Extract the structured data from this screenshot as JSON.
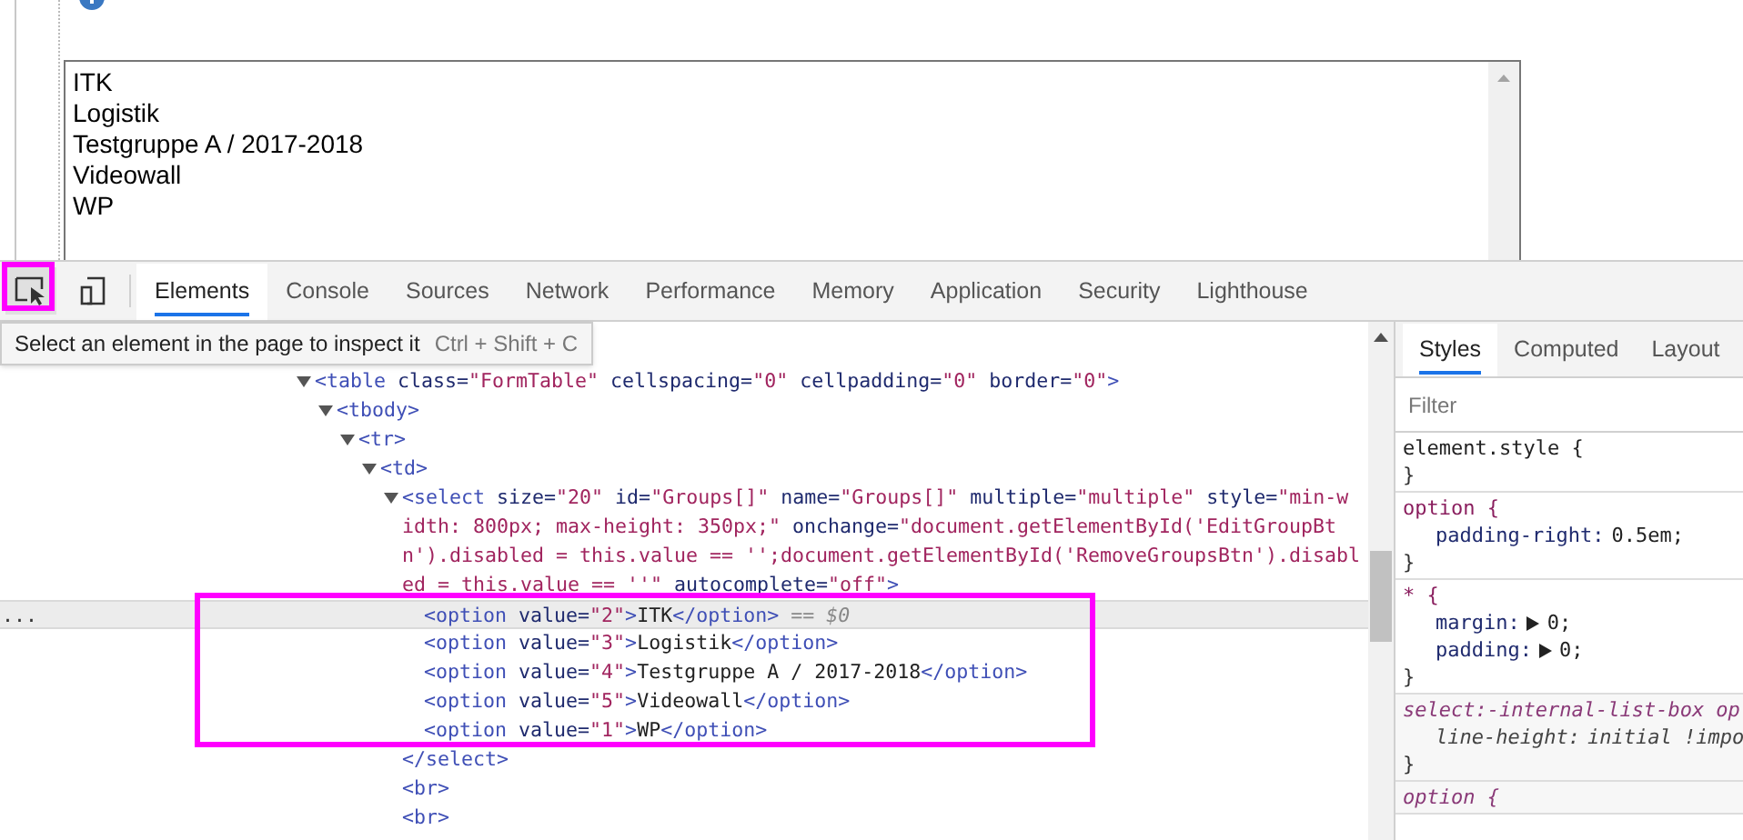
{
  "page": {
    "listbox": {
      "options": [
        {
          "label": "ITK"
        },
        {
          "label": "Logistik"
        },
        {
          "label": "Testgruppe A / 2017-2018"
        },
        {
          "label": "Videowall"
        },
        {
          "label": "WP"
        }
      ]
    }
  },
  "devtools": {
    "tools": [
      {
        "kind": "inspect"
      },
      {
        "kind": "device"
      }
    ],
    "tabs": [
      {
        "label": "Elements",
        "selected": true
      },
      {
        "label": "Console",
        "selected": false
      },
      {
        "label": "Sources",
        "selected": false
      },
      {
        "label": "Network",
        "selected": false
      },
      {
        "label": "Performance",
        "selected": false
      },
      {
        "label": "Memory",
        "selected": false
      },
      {
        "label": "Application",
        "selected": false
      },
      {
        "label": "Security",
        "selected": false
      },
      {
        "label": "Lighthouse",
        "selected": false
      }
    ],
    "tooltip": {
      "text": "Select an element in the page to inspect it",
      "shortcut": "Ctrl + Shift + C"
    },
    "dom": [
      {
        "expanded": true,
        "selected": false,
        "lines": [
          [
            {
              "kind": "tag",
              "text": "<table"
            },
            {
              "kind": "attr",
              "text": " class="
            },
            {
              "kind": "value",
              "text": "\"FormTable\""
            },
            {
              "kind": "attr",
              "text": " cellspacing="
            },
            {
              "kind": "value",
              "text": "\"0\""
            },
            {
              "kind": "attr",
              "text": " cellpadding="
            },
            {
              "kind": "value",
              "text": "\"0\""
            },
            {
              "kind": "attr",
              "text": " border="
            },
            {
              "kind": "value",
              "text": "\"0\""
            },
            {
              "kind": "tag",
              "text": ">"
            }
          ]
        ],
        "children": [
          {
            "expanded": true,
            "selected": false,
            "lines": [
              [
                {
                  "kind": "tag",
                  "text": "<tbody>"
                }
              ]
            ],
            "children": [
              {
                "expanded": true,
                "selected": false,
                "lines": [
                  [
                    {
                      "kind": "tag",
                      "text": "<tr>"
                    }
                  ]
                ],
                "children": [
                  {
                    "expanded": true,
                    "selected": false,
                    "lines": [
                      [
                        {
                          "kind": "tag",
                          "text": "<td>"
                        }
                      ]
                    ],
                    "children": [
                      {
                        "expanded": true,
                        "selected": false,
                        "lines": [
                          [
                            {
                              "kind": "tag",
                              "text": "<select"
                            },
                            {
                              "kind": "attr",
                              "text": " size="
                            },
                            {
                              "kind": "value",
                              "text": "\"20\""
                            },
                            {
                              "kind": "attr",
                              "text": " id="
                            },
                            {
                              "kind": "value",
                              "text": "\"Groups[]\""
                            },
                            {
                              "kind": "attr",
                              "text": " name="
                            },
                            {
                              "kind": "value",
                              "text": "\"Groups[]\""
                            },
                            {
                              "kind": "attr",
                              "text": " multiple="
                            },
                            {
                              "kind": "value",
                              "text": "\"multiple\""
                            },
                            {
                              "kind": "attr",
                              "text": " style="
                            },
                            {
                              "kind": "value",
                              "text": "\"min-w"
                            }
                          ],
                          [
                            {
                              "kind": "value",
                              "text": "idth: 800px; max-height: 350px;\""
                            },
                            {
                              "kind": "attr",
                              "text": " onchange="
                            },
                            {
                              "kind": "value",
                              "text": "\"document.getElementById('EditGroupBt"
                            }
                          ],
                          [
                            {
                              "kind": "value",
                              "text": "n').disabled = this.value == '';document.getElementById('RemoveGroupsBtn').disabl"
                            }
                          ],
                          [
                            {
                              "kind": "value",
                              "text": "ed = this.value == ''\""
                            },
                            {
                              "kind": "attr",
                              "text": " autocomplete="
                            },
                            {
                              "kind": "value",
                              "text": "\"off\""
                            },
                            {
                              "kind": "tag",
                              "text": ">"
                            }
                          ]
                        ],
                        "children": [
                          {
                            "selected": true,
                            "gutter": "...",
                            "lines": [
                              [
                                {
                                  "kind": "tag",
                                  "text": "<option"
                                },
                                {
                                  "kind": "attr",
                                  "text": " value="
                                },
                                {
                                  "kind": "value",
                                  "text": "\"2\""
                                },
                                {
                                  "kind": "tag",
                                  "text": ">"
                                },
                                {
                                  "kind": "text",
                                  "text": "ITK"
                                },
                                {
                                  "kind": "tag",
                                  "text": "</option>"
                                },
                                {
                                  "kind": "ref",
                                  "text": " == $0"
                                }
                              ]
                            ]
                          },
                          {
                            "selected": false,
                            "lines": [
                              [
                                {
                                  "kind": "tag",
                                  "text": "<option"
                                },
                                {
                                  "kind": "attr",
                                  "text": " value="
                                },
                                {
                                  "kind": "value",
                                  "text": "\"3\""
                                },
                                {
                                  "kind": "tag",
                                  "text": ">"
                                },
                                {
                                  "kind": "text",
                                  "text": "Logistik"
                                },
                                {
                                  "kind": "tag",
                                  "text": "</option>"
                                }
                              ]
                            ]
                          },
                          {
                            "selected": false,
                            "lines": [
                              [
                                {
                                  "kind": "tag",
                                  "text": "<option"
                                },
                                {
                                  "kind": "attr",
                                  "text": " value="
                                },
                                {
                                  "kind": "value",
                                  "text": "\"4\""
                                },
                                {
                                  "kind": "tag",
                                  "text": ">"
                                },
                                {
                                  "kind": "text",
                                  "text": "Testgruppe A / 2017-2018"
                                },
                                {
                                  "kind": "tag",
                                  "text": "</option>"
                                }
                              ]
                            ]
                          },
                          {
                            "selected": false,
                            "lines": [
                              [
                                {
                                  "kind": "tag",
                                  "text": "<option"
                                },
                                {
                                  "kind": "attr",
                                  "text": " value="
                                },
                                {
                                  "kind": "value",
                                  "text": "\"5\""
                                },
                                {
                                  "kind": "tag",
                                  "text": ">"
                                },
                                {
                                  "kind": "text",
                                  "text": "Videowall"
                                },
                                {
                                  "kind": "tag",
                                  "text": "</option>"
                                }
                              ]
                            ]
                          },
                          {
                            "selected": false,
                            "lines": [
                              [
                                {
                                  "kind": "tag",
                                  "text": "<option"
                                },
                                {
                                  "kind": "attr",
                                  "text": " value="
                                },
                                {
                                  "kind": "value",
                                  "text": "\"1\""
                                },
                                {
                                  "kind": "tag",
                                  "text": ">"
                                },
                                {
                                  "kind": "text",
                                  "text": "WP"
                                },
                                {
                                  "kind": "tag",
                                  "text": "</option>"
                                }
                              ]
                            ]
                          }
                        ],
                        "close": [
                          {
                            "kind": "tag",
                            "text": "</select>"
                          }
                        ]
                      },
                      {
                        "selected": false,
                        "lines": [
                          [
                            {
                              "kind": "tag",
                              "text": "<br>"
                            }
                          ]
                        ]
                      },
                      {
                        "selected": false,
                        "lines": [
                          [
                            {
                              "kind": "tag",
                              "text": "<br>"
                            }
                          ]
                        ]
                      }
                    ]
                  }
                ]
              }
            ]
          }
        ]
      }
    ],
    "styles": {
      "tabs": [
        {
          "label": "Styles",
          "selected": true
        },
        {
          "label": "Computed",
          "selected": false
        },
        {
          "label": "Layout",
          "selected": false
        }
      ],
      "filter_placeholder": "Filter",
      "rules": [
        {
          "kind": "inline",
          "selector": "element.style {",
          "close": "}"
        },
        {
          "kind": "author",
          "selector": "option {",
          "declarations": [
            {
              "name": "padding-right:",
              "value": "0.5em;",
              "expandable": false
            }
          ],
          "close": "}"
        },
        {
          "kind": "author",
          "selector": "* {",
          "declarations": [
            {
              "name": "margin:",
              "value": "0;",
              "expandable": true
            },
            {
              "name": "padding:",
              "value": "0;",
              "expandable": true
            }
          ],
          "close": "}"
        },
        {
          "kind": "user-agent",
          "selector": "select:-internal-list-box op",
          "declarations": [
            {
              "name": "line-height:",
              "value": "initial !impo",
              "expandable": false
            }
          ],
          "close": "}"
        },
        {
          "kind": "user-agent",
          "selector": "option {"
        }
      ]
    }
  }
}
